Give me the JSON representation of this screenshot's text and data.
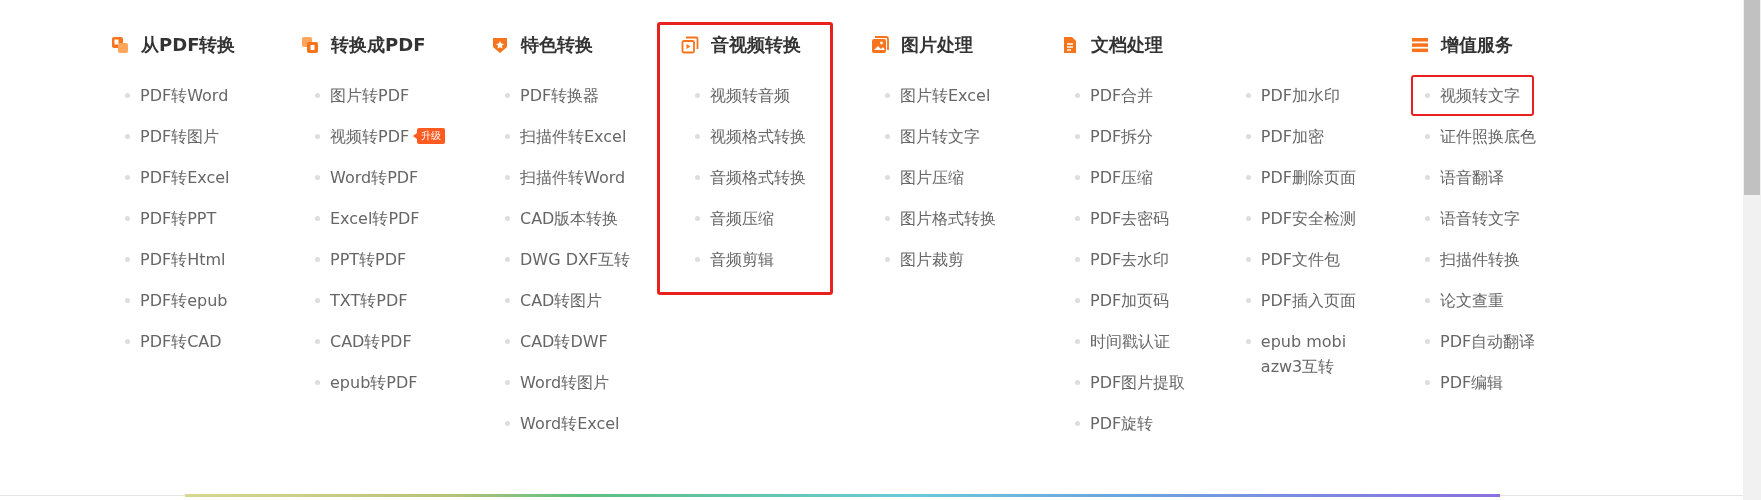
{
  "groups": [
    {
      "kind": "from-pdf",
      "title": "从PDF转换",
      "highlighted": false,
      "columns": [
        [
          {
            "label": "PDF转Word",
            "highlighted": false
          },
          {
            "label": "PDF转图片",
            "highlighted": false
          },
          {
            "label": "PDF转Excel",
            "highlighted": false
          },
          {
            "label": "PDF转PPT",
            "highlighted": false
          },
          {
            "label": "PDF转Html",
            "highlighted": false
          },
          {
            "label": "PDF转epub",
            "highlighted": false
          },
          {
            "label": "PDF转CAD",
            "highlighted": false
          }
        ]
      ]
    },
    {
      "kind": "to-pdf",
      "title": "转换成PDF",
      "highlighted": false,
      "columns": [
        [
          {
            "label": "图片转PDF",
            "highlighted": false
          },
          {
            "label": "视频转PDF",
            "badge": "升级",
            "highlighted": false
          },
          {
            "label": "Word转PDF",
            "highlighted": false
          },
          {
            "label": "Excel转PDF",
            "highlighted": false
          },
          {
            "label": "PPT转PDF",
            "highlighted": false
          },
          {
            "label": "TXT转PDF",
            "highlighted": false
          },
          {
            "label": "CAD转PDF",
            "highlighted": false
          },
          {
            "label": "epub转PDF",
            "highlighted": false
          }
        ]
      ]
    },
    {
      "kind": "special",
      "title": "特色转换",
      "highlighted": false,
      "columns": [
        [
          {
            "label": "PDF转换器",
            "highlighted": false
          },
          {
            "label": "扫描件转Excel",
            "highlighted": false
          },
          {
            "label": "扫描件转Word",
            "highlighted": false
          },
          {
            "label": "CAD版本转换",
            "highlighted": false
          },
          {
            "label": "DWG DXF互转",
            "highlighted": false
          },
          {
            "label": "CAD转图片",
            "highlighted": false
          },
          {
            "label": "CAD转DWF",
            "highlighted": false
          },
          {
            "label": "Word转图片",
            "highlighted": false
          },
          {
            "label": "Word转Excel",
            "highlighted": false
          }
        ]
      ]
    },
    {
      "kind": "media",
      "title": "音视频转换",
      "highlighted": true,
      "columns": [
        [
          {
            "label": "视频转音频",
            "highlighted": false
          },
          {
            "label": "视频格式转换",
            "highlighted": false
          },
          {
            "label": "音频格式转换",
            "highlighted": false
          },
          {
            "label": "音频压缩",
            "highlighted": false
          },
          {
            "label": "音频剪辑",
            "highlighted": false
          }
        ]
      ]
    },
    {
      "kind": "image",
      "title": "图片处理",
      "highlighted": false,
      "columns": [
        [
          {
            "label": "图片转Excel",
            "highlighted": false
          },
          {
            "label": "图片转文字",
            "highlighted": false
          },
          {
            "label": "图片压缩",
            "highlighted": false
          },
          {
            "label": "图片格式转换",
            "highlighted": false
          },
          {
            "label": "图片裁剪",
            "highlighted": false
          }
        ]
      ]
    },
    {
      "kind": "document",
      "title": "文档处理",
      "highlighted": false,
      "columns": [
        [
          {
            "label": "PDF合并",
            "highlighted": false
          },
          {
            "label": "PDF拆分",
            "highlighted": false
          },
          {
            "label": "PDF压缩",
            "highlighted": false
          },
          {
            "label": "PDF去密码",
            "highlighted": false
          },
          {
            "label": "PDF去水印",
            "highlighted": false
          },
          {
            "label": "PDF加页码",
            "highlighted": false
          },
          {
            "label": "时间戳认证",
            "highlighted": false
          },
          {
            "label": "PDF图片提取",
            "highlighted": false
          },
          {
            "label": "PDF旋转",
            "highlighted": false
          }
        ],
        [
          {
            "label": "PDF加水印",
            "highlighted": false
          },
          {
            "label": "PDF加密",
            "highlighted": false
          },
          {
            "label": "PDF删除页面",
            "highlighted": false
          },
          {
            "label": "PDF安全检测",
            "highlighted": false
          },
          {
            "label": "PDF文件包",
            "highlighted": false
          },
          {
            "label": "PDF插入页面",
            "highlighted": false
          },
          {
            "label": "epub mobi azw3互转",
            "highlighted": false
          }
        ]
      ]
    },
    {
      "kind": "service",
      "title": "增值服务",
      "highlighted": false,
      "columns": [
        [
          {
            "label": "视频转文字",
            "highlighted": true
          },
          {
            "label": "证件照换底色",
            "highlighted": false
          },
          {
            "label": "语音翻译",
            "highlighted": false
          },
          {
            "label": "语音转文字",
            "highlighted": false
          },
          {
            "label": "扫描件转换",
            "highlighted": false
          },
          {
            "label": "论文查重",
            "highlighted": false
          },
          {
            "label": "PDF自动翻译",
            "highlighted": false
          },
          {
            "label": "PDF编辑",
            "highlighted": false
          }
        ]
      ]
    }
  ]
}
